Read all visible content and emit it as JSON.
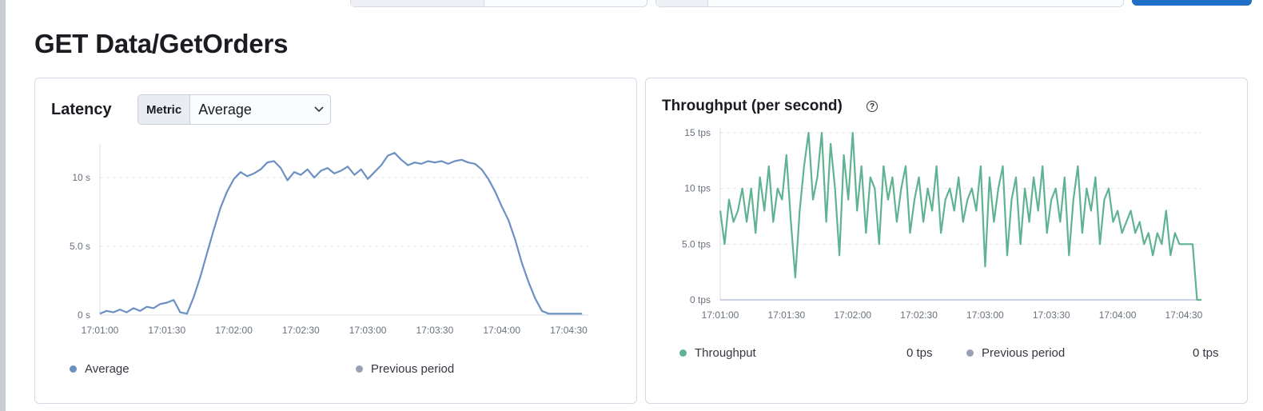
{
  "page": {
    "title": "GET Data/GetOrders"
  },
  "colors": {
    "latency_series": "#6d90c3",
    "throughput_series": "#5fb392",
    "previous_period": "#98a2b3",
    "primary_button": "#1f6fc7"
  },
  "latency": {
    "title": "Latency",
    "metric_prepend": "Metric",
    "metric_value": "Average",
    "legend": {
      "series": "Average",
      "previous": "Previous period"
    }
  },
  "throughput": {
    "title": "Throughput (per second)",
    "info_icon": "question-circle-icon",
    "legend": {
      "series": "Throughput",
      "series_value": "0 tps",
      "previous": "Previous period",
      "previous_value": "0 tps"
    }
  },
  "chart_data": [
    {
      "id": "latency",
      "type": "line",
      "title": "Latency",
      "x_ticks": [
        "17:01:00",
        "17:01:30",
        "17:02:00",
        "17:02:30",
        "17:03:00",
        "17:03:30",
        "17:04:00",
        "17:04:30"
      ],
      "y_ticks": [
        "0 s",
        "5.0 s",
        "10 s"
      ],
      "y_tick_values": [
        0,
        5,
        10
      ],
      "ylim": [
        0,
        12.1
      ],
      "x_unit": "seconds after 17:01:00",
      "xlim": [
        0,
        217
      ],
      "grid": true,
      "series": [
        {
          "name": "Average",
          "x": [
            0,
            3,
            6,
            9,
            12,
            15,
            18,
            21,
            24,
            27,
            30,
            33,
            36,
            39,
            42,
            45,
            48,
            51,
            54,
            57,
            60,
            63,
            66,
            69,
            72,
            75,
            78,
            81,
            84,
            87,
            90,
            93,
            96,
            99,
            102,
            105,
            108,
            111,
            114,
            117,
            120,
            123,
            126,
            129,
            132,
            135,
            138,
            141,
            144,
            147,
            150,
            153,
            156,
            159,
            162,
            165,
            168,
            171,
            174,
            177,
            180,
            183,
            186,
            189,
            192,
            195,
            198,
            201,
            204,
            207,
            210,
            213,
            216
          ],
          "values": [
            0.1,
            0.3,
            0.2,
            0.4,
            0.2,
            0.5,
            0.3,
            0.6,
            0.5,
            0.8,
            0.9,
            1.1,
            0.2,
            0.1,
            1.3,
            2.8,
            4.5,
            6.2,
            7.8,
            9.0,
            9.9,
            10.4,
            10.1,
            10.3,
            10.6,
            11.1,
            11.2,
            10.7,
            9.8,
            10.4,
            10.2,
            10.6,
            10.0,
            10.5,
            10.7,
            10.3,
            10.5,
            10.8,
            10.2,
            10.6,
            9.9,
            10.4,
            10.9,
            11.6,
            11.8,
            11.3,
            10.9,
            11.1,
            11.0,
            11.2,
            11.1,
            11.2,
            11.0,
            11.2,
            11.3,
            11.1,
            11.0,
            10.6,
            9.9,
            9.0,
            7.9,
            6.9,
            5.5,
            3.8,
            2.4,
            1.2,
            0.3,
            0.1,
            0.1,
            0.1,
            0.1,
            0.1,
            0.1
          ]
        }
      ]
    },
    {
      "id": "throughput",
      "type": "line",
      "title": "Throughput (per second)",
      "x_ticks": [
        "17:01:00",
        "17:01:30",
        "17:02:00",
        "17:02:30",
        "17:03:00",
        "17:03:30",
        "17:04:00",
        "17:04:30"
      ],
      "y_ticks": [
        "0 tps",
        "5.0 tps",
        "10 tps",
        "15 tps"
      ],
      "y_tick_values": [
        0,
        5,
        10,
        15
      ],
      "ylim": [
        0,
        15
      ],
      "x_unit": "seconds after 17:01:00",
      "xlim": [
        0,
        218
      ],
      "grid": true,
      "series": [
        {
          "name": "Throughput",
          "x": [
            0,
            2,
            4,
            6,
            8,
            10,
            12,
            14,
            16,
            18,
            20,
            22,
            24,
            26,
            28,
            30,
            32,
            34,
            36,
            38,
            40,
            42,
            44,
            46,
            48,
            50,
            52,
            54,
            56,
            58,
            60,
            62,
            64,
            66,
            68,
            70,
            72,
            74,
            76,
            78,
            80,
            82,
            84,
            86,
            88,
            90,
            92,
            94,
            96,
            98,
            100,
            102,
            104,
            106,
            108,
            110,
            112,
            114,
            116,
            118,
            120,
            122,
            124,
            126,
            128,
            130,
            132,
            134,
            136,
            138,
            140,
            142,
            144,
            146,
            148,
            150,
            152,
            154,
            156,
            158,
            160,
            162,
            164,
            166,
            168,
            170,
            172,
            174,
            176,
            178,
            180,
            182,
            184,
            186,
            188,
            190,
            192,
            194,
            196,
            198,
            200,
            202,
            204,
            206,
            208,
            210,
            212,
            214,
            216,
            218
          ],
          "values": [
            8,
            5,
            9,
            7,
            8,
            10,
            7,
            10,
            6,
            11,
            8,
            12,
            7,
            10,
            9,
            13,
            7,
            2,
            8,
            12,
            15,
            9,
            11,
            15,
            7,
            14,
            10,
            4,
            13,
            9,
            15,
            8,
            12,
            6,
            11,
            10,
            5,
            12,
            9,
            11,
            7,
            10,
            12,
            6,
            9,
            11,
            7,
            10,
            8,
            12,
            6,
            9,
            10,
            8,
            11,
            7,
            9,
            10,
            8,
            12,
            3,
            11,
            7,
            10,
            12,
            4,
            9,
            11,
            5,
            10,
            7,
            11,
            8,
            12,
            6,
            9,
            10,
            7,
            11,
            4,
            9,
            12,
            6,
            10,
            8,
            11,
            5,
            9,
            10,
            7,
            8,
            6,
            7,
            8,
            6,
            7,
            5,
            6,
            4,
            6,
            5,
            8,
            4,
            6,
            5,
            5,
            5,
            5,
            0,
            0
          ]
        }
      ]
    }
  ]
}
